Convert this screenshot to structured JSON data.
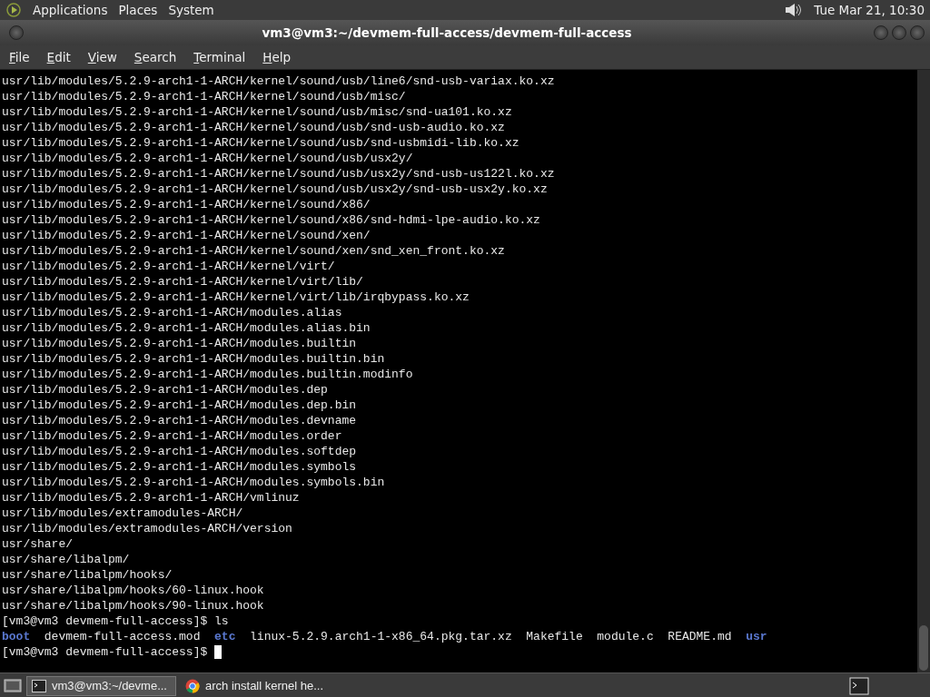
{
  "top_panel": {
    "menus": [
      "Applications",
      "Places",
      "System"
    ],
    "clock": "Tue Mar 21, 10:30"
  },
  "window": {
    "title": "vm3@vm3:~/devmem-full-access/devmem-full-access"
  },
  "menubar": [
    "File",
    "Edit",
    "View",
    "Search",
    "Terminal",
    "Help"
  ],
  "terminal": {
    "lines": [
      "usr/lib/modules/5.2.9-arch1-1-ARCH/kernel/sound/usb/line6/snd-usb-variax.ko.xz",
      "usr/lib/modules/5.2.9-arch1-1-ARCH/kernel/sound/usb/misc/",
      "usr/lib/modules/5.2.9-arch1-1-ARCH/kernel/sound/usb/misc/snd-ua101.ko.xz",
      "usr/lib/modules/5.2.9-arch1-1-ARCH/kernel/sound/usb/snd-usb-audio.ko.xz",
      "usr/lib/modules/5.2.9-arch1-1-ARCH/kernel/sound/usb/snd-usbmidi-lib.ko.xz",
      "usr/lib/modules/5.2.9-arch1-1-ARCH/kernel/sound/usb/usx2y/",
      "usr/lib/modules/5.2.9-arch1-1-ARCH/kernel/sound/usb/usx2y/snd-usb-us122l.ko.xz",
      "usr/lib/modules/5.2.9-arch1-1-ARCH/kernel/sound/usb/usx2y/snd-usb-usx2y.ko.xz",
      "usr/lib/modules/5.2.9-arch1-1-ARCH/kernel/sound/x86/",
      "usr/lib/modules/5.2.9-arch1-1-ARCH/kernel/sound/x86/snd-hdmi-lpe-audio.ko.xz",
      "usr/lib/modules/5.2.9-arch1-1-ARCH/kernel/sound/xen/",
      "usr/lib/modules/5.2.9-arch1-1-ARCH/kernel/sound/xen/snd_xen_front.ko.xz",
      "usr/lib/modules/5.2.9-arch1-1-ARCH/kernel/virt/",
      "usr/lib/modules/5.2.9-arch1-1-ARCH/kernel/virt/lib/",
      "usr/lib/modules/5.2.9-arch1-1-ARCH/kernel/virt/lib/irqbypass.ko.xz",
      "usr/lib/modules/5.2.9-arch1-1-ARCH/modules.alias",
      "usr/lib/modules/5.2.9-arch1-1-ARCH/modules.alias.bin",
      "usr/lib/modules/5.2.9-arch1-1-ARCH/modules.builtin",
      "usr/lib/modules/5.2.9-arch1-1-ARCH/modules.builtin.bin",
      "usr/lib/modules/5.2.9-arch1-1-ARCH/modules.builtin.modinfo",
      "usr/lib/modules/5.2.9-arch1-1-ARCH/modules.dep",
      "usr/lib/modules/5.2.9-arch1-1-ARCH/modules.dep.bin",
      "usr/lib/modules/5.2.9-arch1-1-ARCH/modules.devname",
      "usr/lib/modules/5.2.9-arch1-1-ARCH/modules.order",
      "usr/lib/modules/5.2.9-arch1-1-ARCH/modules.softdep",
      "usr/lib/modules/5.2.9-arch1-1-ARCH/modules.symbols",
      "usr/lib/modules/5.2.9-arch1-1-ARCH/modules.symbols.bin",
      "usr/lib/modules/5.2.9-arch1-1-ARCH/vmlinuz",
      "usr/lib/modules/extramodules-ARCH/",
      "usr/lib/modules/extramodules-ARCH/version",
      "usr/share/",
      "usr/share/libalpm/",
      "usr/share/libalpm/hooks/",
      "usr/share/libalpm/hooks/60-linux.hook",
      "usr/share/libalpm/hooks/90-linux.hook",
      "[vm3@vm3 devmem-full-access]$ ls"
    ],
    "listing": [
      {
        "name": "boot",
        "kind": "dir"
      },
      {
        "name": "devmem-full-access.mod",
        "kind": "file"
      },
      {
        "name": "etc",
        "kind": "dir"
      },
      {
        "name": "linux-5.2.9.arch1-1-x86_64.pkg.tar.xz",
        "kind": "file"
      },
      {
        "name": "Makefile",
        "kind": "file"
      },
      {
        "name": "module.c",
        "kind": "file"
      },
      {
        "name": "README.md",
        "kind": "file"
      },
      {
        "name": "usr",
        "kind": "dir"
      }
    ],
    "prompt": "[vm3@vm3 devmem-full-access]$"
  },
  "taskbar": {
    "tasks": [
      {
        "label": "vm3@vm3:~/devme...",
        "selected": true,
        "kind": "terminal"
      },
      {
        "label": "arch install kernel he...",
        "selected": false,
        "kind": "browser"
      }
    ]
  }
}
